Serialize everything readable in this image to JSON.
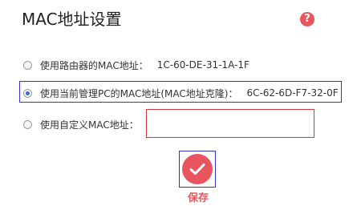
{
  "page": {
    "title": "MAC地址设置",
    "help_icon": "help-icon",
    "help_symbol": "?"
  },
  "options": [
    {
      "label": "使用路由器的MAC地址：",
      "mac": "1C-60-DE-31-1A-1F",
      "checked": false
    },
    {
      "label": "使用当前管理PC的MAC地址(MAC地址克隆)：",
      "mac": "6C-62-6D-F7-32-0F",
      "checked": true
    },
    {
      "label": "使用自定义MAC地址：",
      "input_value": "",
      "checked": false
    }
  ],
  "save": {
    "label": "保存",
    "icon": "checkmark-icon"
  },
  "colors": {
    "accent": "#e8555f",
    "focus_border": "#3035c8",
    "input_border": "#d8343d",
    "radio_fill": "#3b6ec4"
  }
}
